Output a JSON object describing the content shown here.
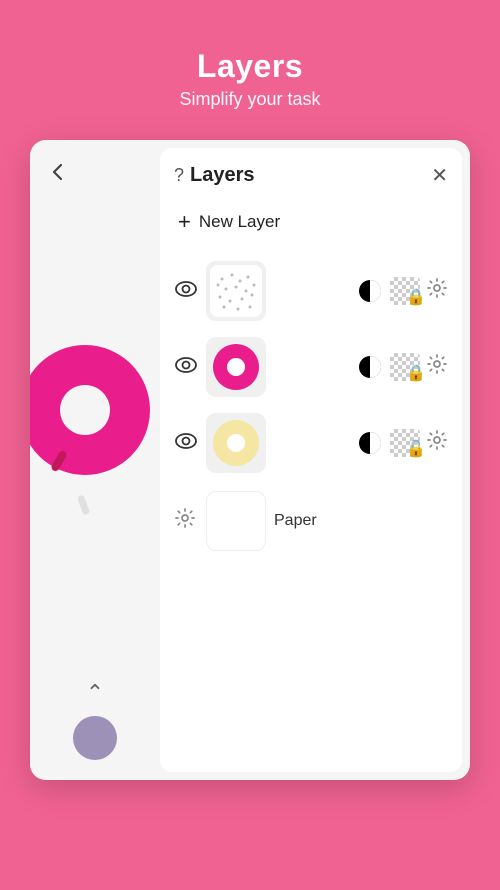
{
  "header": {
    "title": "Layers",
    "subtitle": "Simplify your task"
  },
  "panel": {
    "title": "Layers",
    "help_label": "?",
    "close_label": "✕",
    "new_layer_label": "New Layer",
    "new_layer_plus": "+"
  },
  "layers": [
    {
      "id": "layer1",
      "type": "dots",
      "visible": true
    },
    {
      "id": "layer2",
      "type": "donut-pink",
      "visible": true
    },
    {
      "id": "layer3",
      "type": "donut-yellow",
      "visible": true
    },
    {
      "id": "layer4",
      "type": "paper",
      "label": "Paper",
      "visible": true
    }
  ],
  "canvas": {
    "back_label": "←",
    "up_label": "∧",
    "color_accent": "#9E91B8"
  }
}
